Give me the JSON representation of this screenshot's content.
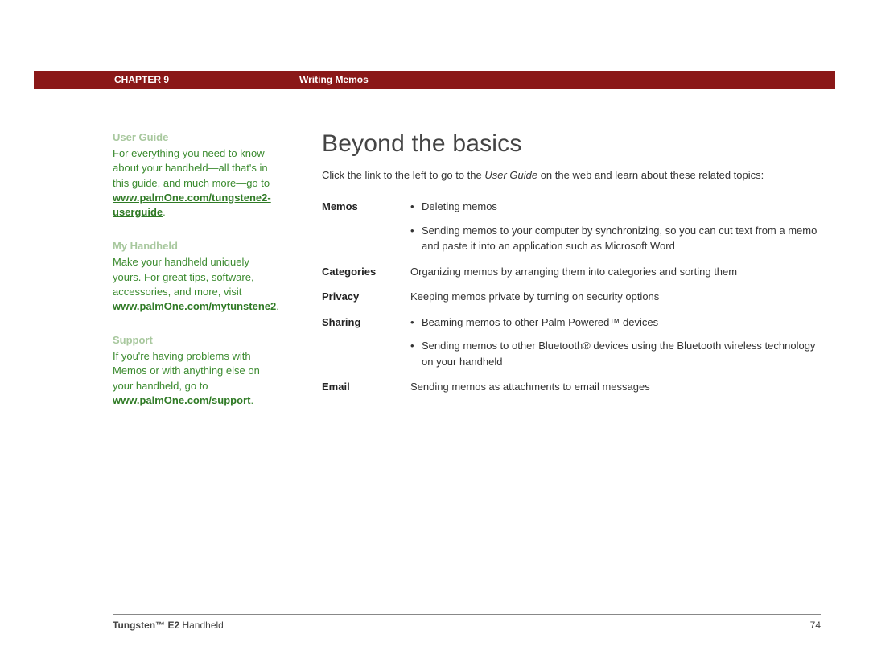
{
  "header": {
    "chapter": "CHAPTER 9",
    "title": "Writing Memos"
  },
  "sidebar": {
    "sections": [
      {
        "heading": "User Guide",
        "text": "For everything you need to know about your handheld—all that's in this guide, and much more—go to ",
        "link": "www.palmOne.com/tungstene2-userguide",
        "after": "."
      },
      {
        "heading": "My Handheld",
        "text": "Make your handheld uniquely yours. For great tips, software, accessories, and more, visit ",
        "link": "www.palmOne.com/mytunstene2",
        "after": "."
      },
      {
        "heading": "Support",
        "text": "If you're having problems with Memos or with anything else on your handheld, go to ",
        "link": "www.palmOne.com/support",
        "after": "."
      }
    ]
  },
  "content": {
    "title": "Beyond the basics",
    "intro_pre": "Click the link to the left to go to the ",
    "intro_italic": "User Guide",
    "intro_post": " on the web and learn about these related topics:",
    "topics": [
      {
        "label": "Memos",
        "bullets": [
          "Deleting memos",
          "Sending memos to your computer by synchronizing, so you can cut text from a memo and paste it into an application such as Microsoft Word"
        ]
      },
      {
        "label": "Categories",
        "text": "Organizing memos by arranging them into categories and sorting them"
      },
      {
        "label": "Privacy",
        "text": "Keeping memos private by turning on security options"
      },
      {
        "label": "Sharing",
        "bullets": [
          "Beaming memos to other Palm Powered™ devices",
          "Sending memos to other Bluetooth® devices using the Bluetooth wireless technology on your handheld"
        ]
      },
      {
        "label": "Email",
        "text": "Sending memos as attachments to email messages"
      }
    ]
  },
  "footer": {
    "product_bold": "Tungsten™ E2",
    "product_rest": " Handheld",
    "page": "74"
  }
}
